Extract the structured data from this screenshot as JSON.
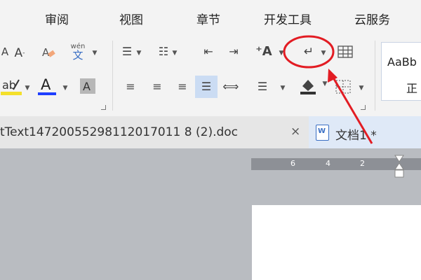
{
  "menu": {
    "items": [
      "审阅",
      "视图",
      "章节",
      "开发工具",
      "云服务"
    ]
  },
  "ribbon": {
    "phonetic_top": "wén",
    "phonetic_bottom": "文",
    "style_preview": "AaBb",
    "style_name": "正"
  },
  "tabs": {
    "inactive_label": "tText14720055298112017011 8 (2).doc",
    "close_symbol": "×",
    "active_label": "文档1 *"
  },
  "ruler": {
    "numbers": [
      "6",
      "4",
      "2"
    ]
  },
  "colors": {
    "annotation": "#e21c23",
    "font_color_bar": "#1f3fff",
    "highlight_bar": "#f4e02b",
    "active_tab_bg": "#dfe9f7"
  }
}
